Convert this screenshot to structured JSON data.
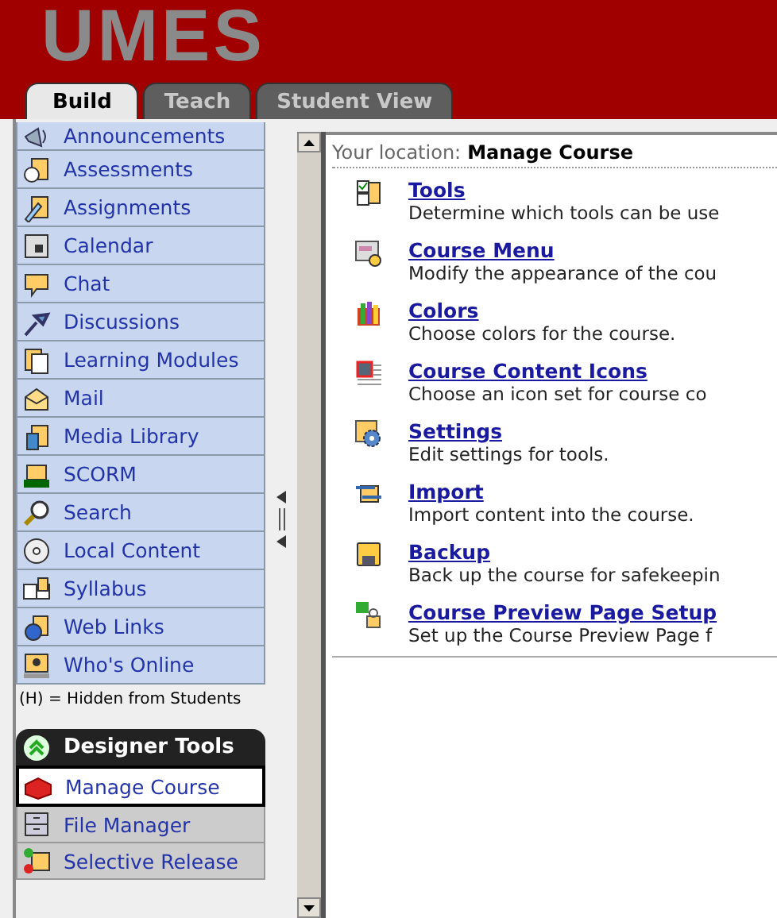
{
  "header": {
    "logo": "UMES"
  },
  "tabs": [
    {
      "label": "Build",
      "selected": true
    },
    {
      "label": "Teach",
      "selected": false
    },
    {
      "label": "Student View",
      "selected": false
    }
  ],
  "sidebar": {
    "items": [
      {
        "label": "Announcements"
      },
      {
        "label": "Assessments"
      },
      {
        "label": "Assignments"
      },
      {
        "label": "Calendar"
      },
      {
        "label": "Chat"
      },
      {
        "label": "Discussions"
      },
      {
        "label": "Learning Modules"
      },
      {
        "label": "Mail"
      },
      {
        "label": "Media Library"
      },
      {
        "label": "SCORM"
      },
      {
        "label": "Search"
      },
      {
        "label": "Local Content"
      },
      {
        "label": "Syllabus"
      },
      {
        "label": "Web Links"
      },
      {
        "label": "Who's Online"
      }
    ],
    "note": "(H) = Hidden from Students",
    "designer_tools": {
      "title": "Designer Tools",
      "items": [
        {
          "label": "Manage Course",
          "selected": true
        },
        {
          "label": "File Manager",
          "selected": false
        },
        {
          "label": "Selective Release",
          "selected": false
        }
      ]
    }
  },
  "content": {
    "location_label": "Your location:",
    "location": "Manage Course",
    "items": [
      {
        "title": "Tools",
        "description": "Determine which tools can be use"
      },
      {
        "title": "Course Menu",
        "description": "Modify the appearance of the cou"
      },
      {
        "title": "Colors",
        "description": "Choose colors for the course."
      },
      {
        "title": "Course Content Icons",
        "description": "Choose an icon set for course co"
      },
      {
        "title": "Settings",
        "description": "Edit settings for tools."
      },
      {
        "title": "Import",
        "description": "Import content into the course."
      },
      {
        "title": "Backup",
        "description": "Back up the course for safekeepin"
      },
      {
        "title": "Course Preview Page Setup",
        "description": "Set up the Course Preview Page f"
      }
    ]
  }
}
